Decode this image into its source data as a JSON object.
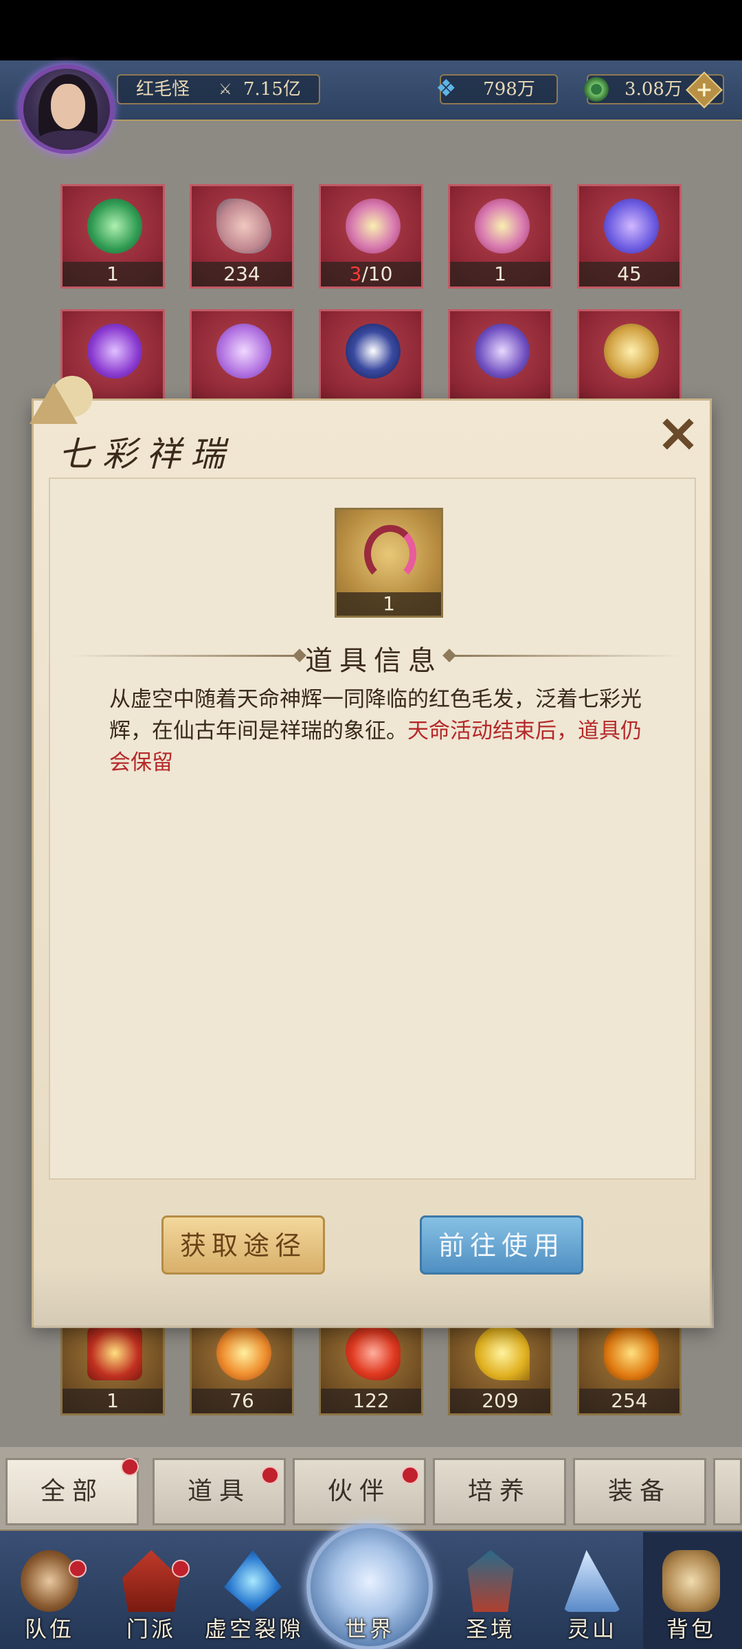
{
  "header": {
    "player_name": "红毛怪",
    "power": "7.15亿",
    "jade": "798万",
    "coins": "3.08万",
    "plus_label": "+"
  },
  "inventory": {
    "row1": [
      "1",
      "234",
      "",
      "1",
      "45"
    ],
    "row1_fragment": {
      "have": "3",
      "need": "/10"
    },
    "row3": [
      "1",
      "76",
      "122",
      "209",
      "254"
    ]
  },
  "dialog": {
    "title": "七彩祥瑞",
    "close_label": "✕",
    "item_count": "1",
    "section_title": "道具信息",
    "description": "从虚空中随着天命神辉一同降临的红色毛发，泛着七彩光辉，在仙古年间是祥瑞的象征。",
    "description_highlight": "天命活动结束后，道具仍会保留",
    "btn_source": "获取途径",
    "btn_use": "前往使用"
  },
  "tabs": [
    "全部",
    "道具",
    "伙伴",
    "培养",
    "装备"
  ],
  "nav": [
    "队伍",
    "门派",
    "虚空裂隙",
    "世界",
    "圣境",
    "灵山",
    "背包"
  ],
  "colors": {
    "accent_red": "#b52a2a",
    "slot_red": "#8c2634",
    "slot_gold": "#6e4c22",
    "button_blue": "#4f8fc2",
    "button_gold": "#d8b06a",
    "badge_red": "#c0212c"
  },
  "icons": [
    "power-icon",
    "jade-icon",
    "coin-icon",
    "plus-icon",
    "close-icon"
  ]
}
